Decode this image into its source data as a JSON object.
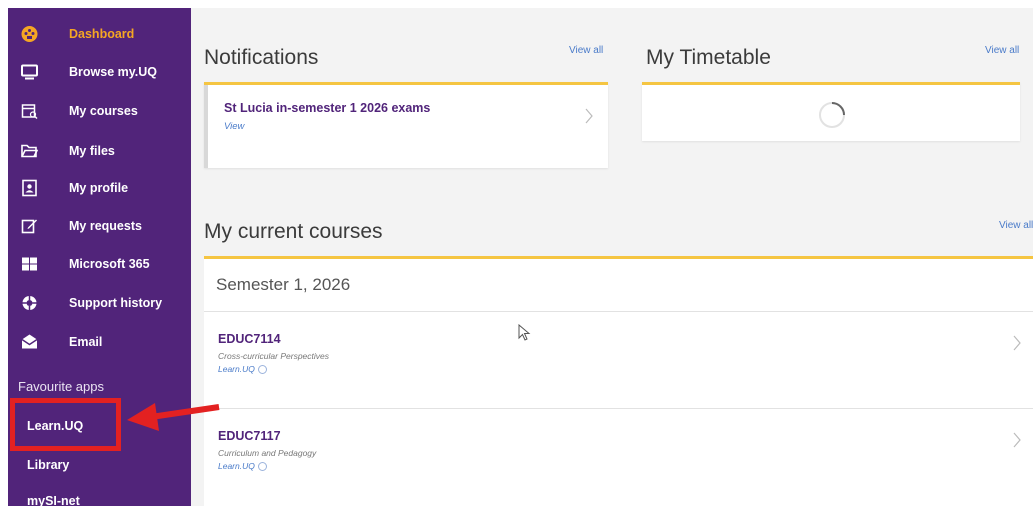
{
  "sidebar": {
    "items": [
      {
        "label": "Dashboard",
        "icon": "dashboard-icon",
        "active": true
      },
      {
        "label": "Browse my.UQ",
        "icon": "monitor-icon"
      },
      {
        "label": "My courses",
        "icon": "calendar-icon"
      },
      {
        "label": "My files",
        "icon": "folder-icon"
      },
      {
        "label": "My profile",
        "icon": "profile-icon"
      },
      {
        "label": "My requests",
        "icon": "edit-icon"
      },
      {
        "label": "Microsoft 365",
        "icon": "grid-icon"
      },
      {
        "label": "Support history",
        "icon": "lifebuoy-icon"
      },
      {
        "label": "Email",
        "icon": "envelope-icon"
      }
    ],
    "fav_header": "Favourite apps",
    "fav_items": [
      {
        "label": "Learn.UQ"
      },
      {
        "label": "Library"
      },
      {
        "label": "mySI-net"
      }
    ]
  },
  "notifications": {
    "title": "Notifications",
    "view_all": "View all",
    "item_title": "St Lucia in-semester 1 2026 exams",
    "item_link": "View"
  },
  "timetable": {
    "title": "My Timetable",
    "view_all": "View all",
    "loading": true
  },
  "courses": {
    "title": "My current courses",
    "view_all": "View all",
    "semester": "Semester 1, 2026",
    "list": [
      {
        "code": "EDUC7114",
        "name": "Cross-curricular Perspectives",
        "link": "Learn.UQ"
      },
      {
        "code": "EDUC7117",
        "name": "Curriculum and Pedagogy",
        "link": "Learn.UQ"
      }
    ]
  },
  "colors": {
    "sidebar_bg": "#51247a",
    "accent_gold": "#f5c542",
    "active_label": "#f5a623",
    "link_blue": "#4a7bc9",
    "annotation_red": "#e32121"
  }
}
